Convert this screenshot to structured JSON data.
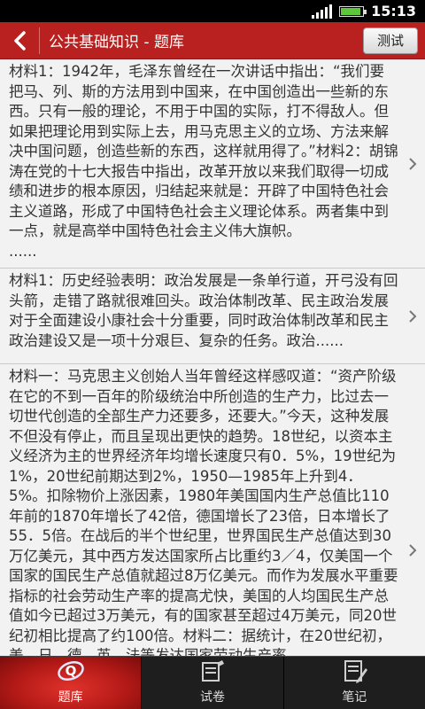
{
  "status": {
    "time": "15:13"
  },
  "header": {
    "title": "公共基础知识 - 题库",
    "test_label": "测试"
  },
  "items": [
    {
      "text": "材料1：1942年，毛泽东曾经在一次讲话中指出：“我们要把马、列、斯的方法用到中国来，在中国创造出一些新的东西。只有一般的理论，不用于中国的实际，打不得敌人。但如果把理论用到实际上去，用马克思主义的立场、方法来解决中国问题，创造些新的东西，这样就用得了。”材料2：胡锦涛在党的十七大报告中指出，改革开放以来我们取得一切成绩和进步的根本原因，归结起来就是：开辟了中国特色社会主义道路，形成了中国特色社会主义理论体系。两者集中到一点，就是高举中国特色社会主义伟大旗帜。\n......"
    },
    {
      "text": "材料1：历史经验表明：政治发展是一条单行道，开弓没有回头箭，走错了路就很难回头。政治体制改革、民主政治发展对于全面建设小康社会十分重要，同时政治体制改革和民主政治建设又是一项十分艰巨、复杂的任务。政治......"
    },
    {
      "text": "材料一：马克思主义创始人当年曾经这样感叹道：“资产阶级在它的不到一百年的阶级统治中所创造的生产力，比过去一切世代创造的全部生产力还要多，还要大。”今天，这种发展不但没有停止，而且呈现出更快的趋势。18世纪，以资本主义经济为主的世界经济年均增长速度只有0．5%，19世纪为1%，20世纪前期达到2%，1950—1985年上升到4．5%。扣除物价上涨因素，1980年美国国内生产总值比110年前的1870年增长了42倍，德国增长了23倍，日本增长了55．5倍。在战后的半个世纪里，世界国民生产总值达到30万亿美元，其中西方发达国家所占比重约3／4，仅美国一个国家的国民生产总值就超过8万亿美元。而作为发展水平重要指标的社会劳动生产率的提高尤快，美国的人均国民生产总值如今已超过3万美元，有的国家甚至超过4万美元，同20世纪初相比提高了约100倍。材料二：据统计，在20世纪初，美、日、德、英、法等发达国家劳动生产率"
    }
  ],
  "nav": [
    {
      "label": "题库",
      "icon": "question-bank-icon",
      "active": true
    },
    {
      "label": "试卷",
      "icon": "exam-paper-icon",
      "active": false
    },
    {
      "label": "笔记",
      "icon": "notes-icon",
      "active": false
    }
  ],
  "colors": {
    "accent": "#b8211f",
    "nav_bg": "#1e1e1e",
    "content_bg": "#f2f2f2"
  }
}
